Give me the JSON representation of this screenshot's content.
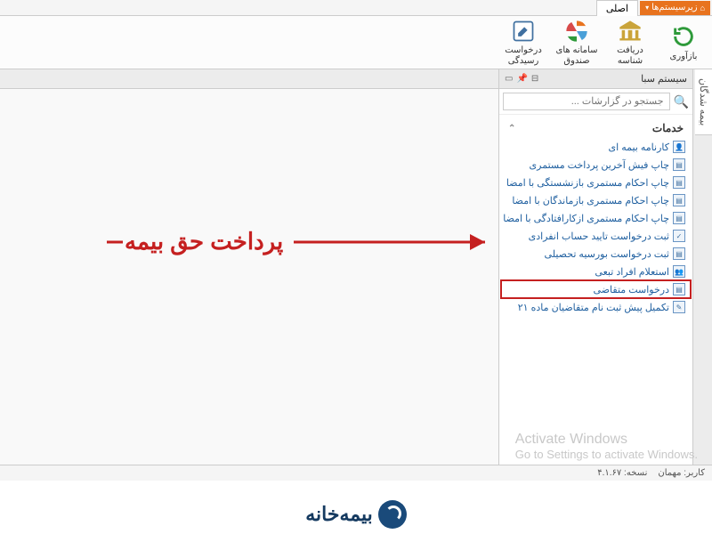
{
  "topbar": {
    "subsystems_label": "زیرسیستم‌ها",
    "main_tab": "اصلی"
  },
  "toolbar": {
    "refresh": "بازآوری",
    "get_id": "دریافت شناسه",
    "fund_systems": "سامانه های صندوق",
    "request": "درخواست رسیدگی"
  },
  "panel": {
    "title": "سیستم سبا",
    "search_placeholder": "جستجو در گزارشات ..."
  },
  "side_tab": "بیمه شدگان",
  "tree": {
    "header": "خدمات",
    "items": [
      "کارنامه بیمه ای",
      "چاپ فیش آخرین پرداخت مستمری",
      "چاپ احکام مستمری بازنشستگی با امضا",
      "چاپ احکام مستمری بازماندگان با امضا",
      "چاپ احکام مستمری ازکارافتادگی با امضا",
      "ثبت درخواست تایید حساب انفرادی",
      "ثبت درخواست بورسیه تحصیلی",
      "استعلام افراد تبعی",
      "درخواست متقاضی",
      "تکمیل پیش ثبت نام متقاضیان ماده ۲۱"
    ]
  },
  "annotation": "پرداخت حق بیمه",
  "watermark": {
    "title": "Activate Windows",
    "sub": "Go to Settings to activate Windows."
  },
  "statusbar": {
    "user": "کاربر: مهمان",
    "version": "نسخه: ۴.۱.۶۷"
  },
  "brand": "بیمه‌خانه"
}
